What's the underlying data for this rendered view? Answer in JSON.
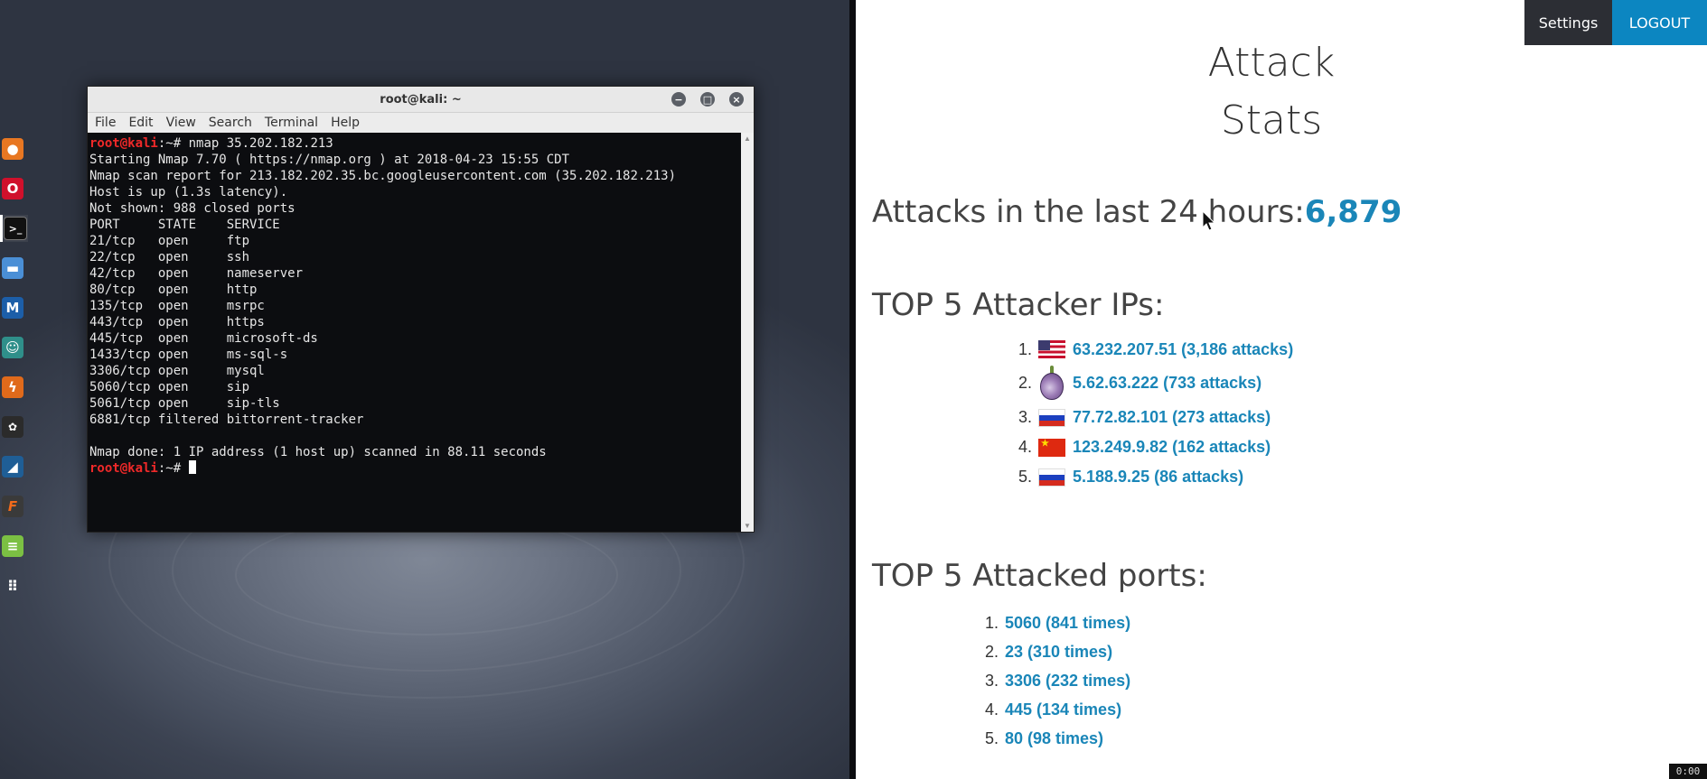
{
  "terminal": {
    "title": "root@kali: ~",
    "menu": [
      "File",
      "Edit",
      "View",
      "Search",
      "Terminal",
      "Help"
    ],
    "prompt_user": "root@kali",
    "prompt_suffix": ":~#",
    "command": " nmap 35.202.182.213",
    "output": [
      "Starting Nmap 7.70 ( https://nmap.org ) at 2018-04-23 15:55 CDT",
      "Nmap scan report for 213.182.202.35.bc.googleusercontent.com (35.202.182.213)",
      "Host is up (1.3s latency).",
      "Not shown: 988 closed ports",
      "PORT     STATE    SERVICE",
      "21/tcp   open     ftp",
      "22/tcp   open     ssh",
      "42/tcp   open     nameserver",
      "80/tcp   open     http",
      "135/tcp  open     msrpc",
      "443/tcp  open     https",
      "445/tcp  open     microsoft-ds",
      "1433/tcp open     ms-sql-s",
      "3306/tcp open     mysql",
      "5060/tcp open     sip",
      "5061/tcp open     sip-tls",
      "6881/tcp filtered bittorrent-tracker",
      "",
      "Nmap done: 1 IP address (1 host up) scanned in 88.11 seconds"
    ]
  },
  "webpage": {
    "settings_label": "Settings",
    "logout_label": "LOGOUT",
    "title_line1": "Attack",
    "title_line2": "Stats",
    "attacks_label": "Attacks in the last 24 hours:",
    "attacks_count": "6,879",
    "top_ips_title": "TOP 5 Attacker IPs:",
    "top_ips": [
      {
        "rank": "1.",
        "flag": "us-flag",
        "text": "63.232.207.51 (3,186 attacks)"
      },
      {
        "rank": "2.",
        "flag": "tor-onion",
        "text": "5.62.63.222 (733 attacks)"
      },
      {
        "rank": "3.",
        "flag": "ru-flag",
        "text": "77.72.82.101 (273 attacks)"
      },
      {
        "rank": "4.",
        "flag": "cn-flag",
        "text": "123.249.9.82 (162 attacks)"
      },
      {
        "rank": "5.",
        "flag": "ru-flag",
        "text": "5.188.9.25 (86 attacks)"
      }
    ],
    "top_ports_title": "TOP 5 Attacked ports:",
    "top_ports": [
      {
        "rank": "1.",
        "text": "5060 (841 times)"
      },
      {
        "rank": "2.",
        "text": "23 (310 times)"
      },
      {
        "rank": "3.",
        "text": "3306 (232 times)"
      },
      {
        "rank": "4.",
        "text": "445 (134 times)"
      },
      {
        "rank": "5.",
        "text": "80 (98 times)"
      }
    ]
  },
  "dock": [
    "firefox-icon",
    "opera-icon",
    "terminal-icon",
    "files-icon",
    "metasploit-icon",
    "armitage-icon",
    "burpsuite-icon",
    "maltego-icon",
    "wireshark-icon",
    "faraday-icon",
    "leafpad-icon",
    "app-grid-icon"
  ],
  "clock": "0:00"
}
